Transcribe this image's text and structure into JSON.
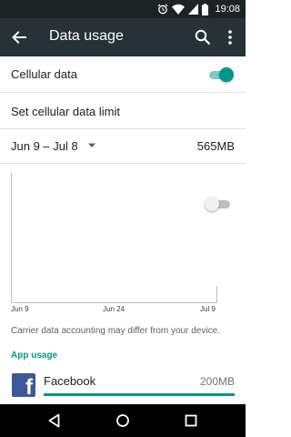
{
  "status_bar": {
    "time": "19:08",
    "icons": [
      "alarm-icon",
      "wifi-icon",
      "cellular-signal-icon",
      "battery-icon"
    ]
  },
  "toolbar": {
    "title": "Data usage",
    "icons": [
      "back-arrow-icon",
      "search-icon",
      "more-vert-icon"
    ]
  },
  "settings": {
    "cellular_data": {
      "label": "Cellular data",
      "enabled": true
    },
    "data_limit": {
      "label": "Set cellular data limit",
      "enabled": false
    }
  },
  "cycle": {
    "range": "Jun 9 – Jul 8",
    "total": "565MB"
  },
  "chart_data": {
    "type": "line",
    "x_ticks": [
      "Jun 9",
      "Jun 24",
      "Jul 9"
    ],
    "series": []
  },
  "note": "Carrier data accounting may differ from your device.",
  "app_usage": {
    "heading": "App usage",
    "apps": [
      {
        "name": "Facebook",
        "size": "200MB",
        "icon": "facebook-icon",
        "share": 1.0
      }
    ]
  },
  "colors": {
    "accent": "#009688",
    "toolbar": "#263238",
    "status_bar": "#1d2225",
    "facebook": "#3b5998"
  },
  "nav_bar": {
    "buttons": [
      "nav-back-icon",
      "nav-home-icon",
      "nav-recents-icon"
    ]
  }
}
